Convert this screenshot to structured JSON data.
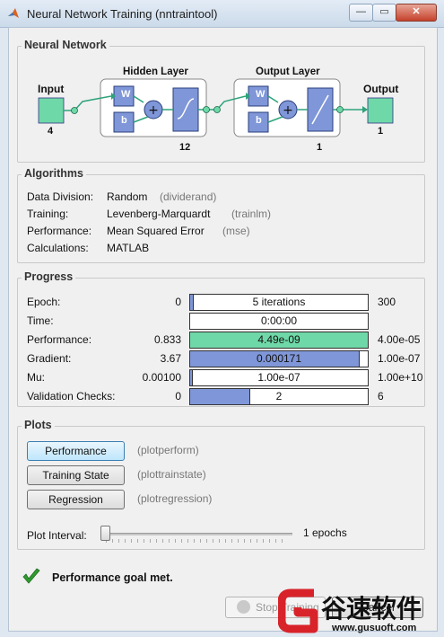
{
  "window": {
    "title": "Neural Network Training (nntraintool)",
    "btn_min": "—",
    "btn_max": "▭",
    "btn_close": "✕"
  },
  "network": {
    "group_title": "Neural Network",
    "input_label": "Input",
    "input_size": "4",
    "hidden_label": "Hidden Layer",
    "hidden_size": "12",
    "output_layer_label": "Output Layer",
    "output_layer_size": "1",
    "output_label": "Output",
    "output_size": "1",
    "w_label": "W",
    "b_label": "b"
  },
  "algorithms": {
    "group_title": "Algorithms",
    "rows": [
      {
        "label": "Data Division:",
        "value": "Random",
        "fn": "(dividerand)"
      },
      {
        "label": "Training:",
        "value": "Levenberg-Marquardt",
        "fn": "(trainlm)"
      },
      {
        "label": "Performance:",
        "value": "Mean Squared Error",
        "fn": "(mse)"
      },
      {
        "label": "Calculations:",
        "value": "MATLAB",
        "fn": ""
      }
    ]
  },
  "progress": {
    "group_title": "Progress",
    "rows": [
      {
        "label": "Epoch:",
        "start": "0",
        "current": "5 iterations",
        "end": "300",
        "fill": 0.017,
        "color": "#7f96d8"
      },
      {
        "label": "Time:",
        "start": "",
        "current": "0:00:00",
        "end": "",
        "fill": 0,
        "color": "#7f96d8"
      },
      {
        "label": "Performance:",
        "start": "0.833",
        "current": "4.49e-09",
        "end": "4.00e-05",
        "fill": 1.0,
        "color": "#6fd8a8"
      },
      {
        "label": "Gradient:",
        "start": "3.67",
        "current": "0.000171",
        "end": "1.00e-07",
        "fill": 0.95,
        "color": "#7f96d8"
      },
      {
        "label": "Mu:",
        "start": "0.00100",
        "current": "1.00e-07",
        "end": "1.00e+10",
        "fill": 0.01,
        "color": "#7f96d8"
      },
      {
        "label": "Validation Checks:",
        "start": "0",
        "current": "2",
        "end": "6",
        "fill": 0.333,
        "color": "#7f96d8"
      }
    ]
  },
  "plots": {
    "group_title": "Plots",
    "buttons": [
      {
        "label": "Performance",
        "hint": "(plotperform)"
      },
      {
        "label": "Training State",
        "hint": "(plottrainstate)"
      },
      {
        "label": "Regression",
        "hint": "(plotregression)"
      }
    ],
    "interval_label": "Plot Interval:",
    "interval_value": "1 epochs"
  },
  "status": {
    "message": "Performance goal met.",
    "check_color": "#2e9c2e"
  },
  "footer": {
    "stop_label": "Stop Training",
    "cancel_label": "Cancel"
  },
  "watermark": {
    "brand": "谷速软件",
    "url": "www.gusuoft.com"
  }
}
